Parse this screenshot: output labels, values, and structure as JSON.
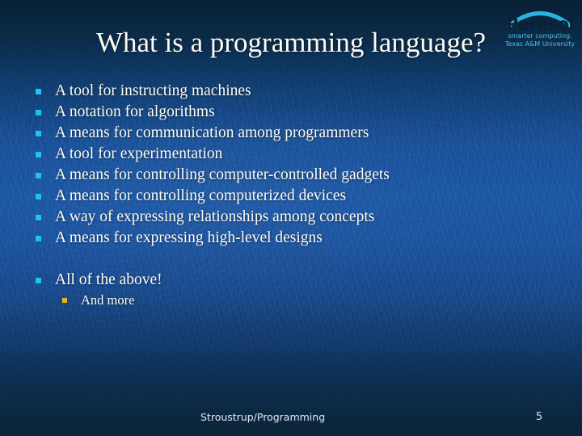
{
  "slide": {
    "title": "What is a programming language?",
    "bullets": [
      "A tool for instructing machines",
      "A notation for algorithms",
      "A means for communication among programmers",
      "A tool for experimentation",
      "A means for controlling computer-controlled gadgets",
      "A means for controlling computerized devices",
      "A way of expressing relationships among concepts",
      "A means for expressing high-level designs"
    ],
    "summary_bullet": "All of the above!",
    "sub_bullet": "And more",
    "footer": "Stroustrup/Programming",
    "page_number": "5"
  },
  "logo": {
    "wordmark": "Parasol",
    "tagline": "smarter computing.",
    "affiliation": "Texas A&M University",
    "arc_color": "#2ab3e0",
    "wordmark_color": "#0c2136"
  },
  "colors": {
    "bullet_marker": "#1fc3f0",
    "sub_bullet_marker": "#f0b416",
    "text": "#fdfbf2",
    "background_top": "#072034",
    "background_mid": "#1a56a5",
    "background_bottom": "#0a2438"
  }
}
